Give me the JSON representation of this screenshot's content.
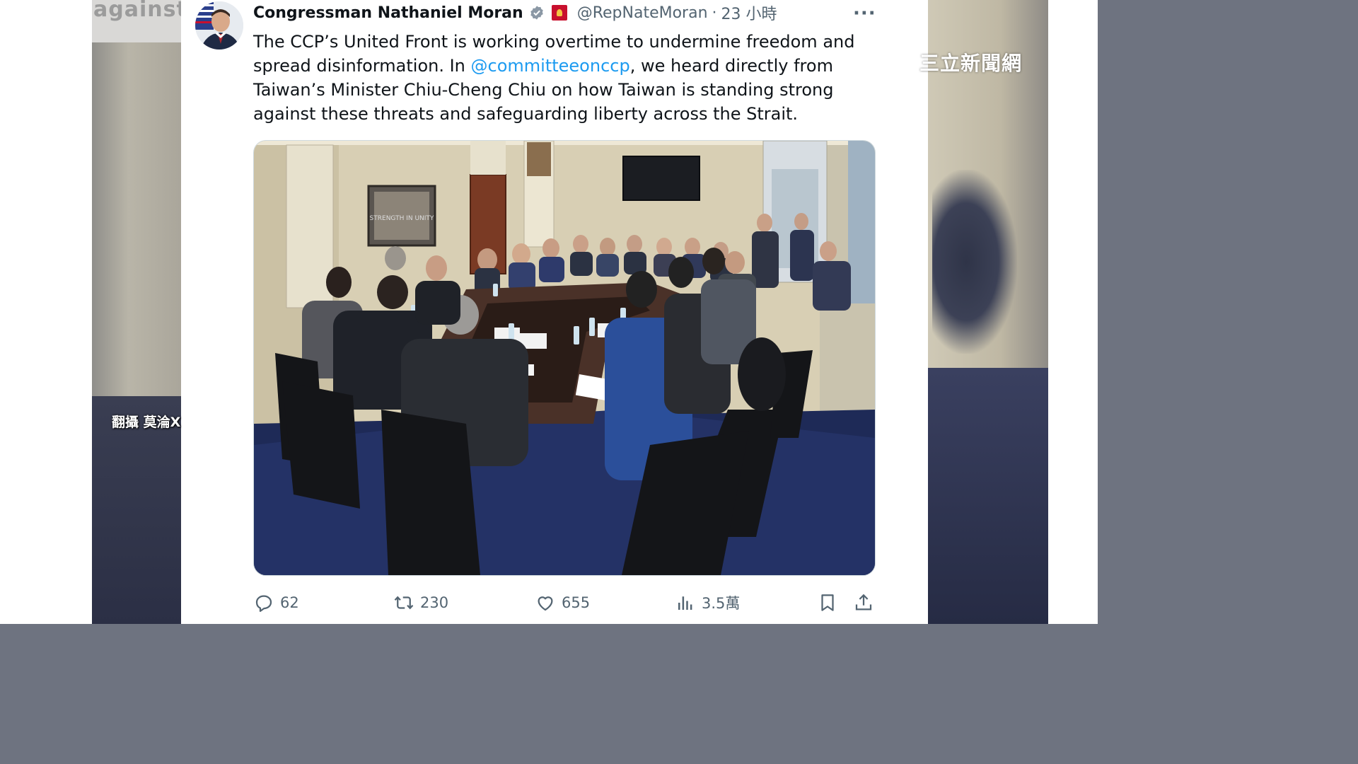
{
  "background": {
    "partial_text_left": "against",
    "watermark": "三立新聞網",
    "credit": "翻攝 莫淪X"
  },
  "tweet": {
    "author_name": "Congressman Nathaniel Moran",
    "handle": "@RepNateMoran",
    "separator": "·",
    "time": "23 小時",
    "more_label": "···",
    "text_before_mention": "The CCP’s United Front is working overtime to undermine freedom and spread disinformation. In ",
    "mention": "@committeeonccp",
    "text_after_mention": ", we heard directly from Taiwan’s Minister Chiu-Cheng Chiu on how Taiwan is standing strong against these threats and safeguarding liberty across the Strait.",
    "photo_sign_text": "STRENGTH IN UNITY"
  },
  "actions": {
    "replies": "62",
    "reposts": "230",
    "likes": "655",
    "views": "3.5萬"
  },
  "colors": {
    "link": "#1d9bf0",
    "text": "#0f1419",
    "muted": "#536471",
    "verified": "#8b98a5"
  },
  "icons": [
    "reply-icon",
    "repost-icon",
    "like-icon",
    "views-icon",
    "bookmark-icon",
    "share-icon",
    "verified-badge-icon",
    "more-icon"
  ]
}
